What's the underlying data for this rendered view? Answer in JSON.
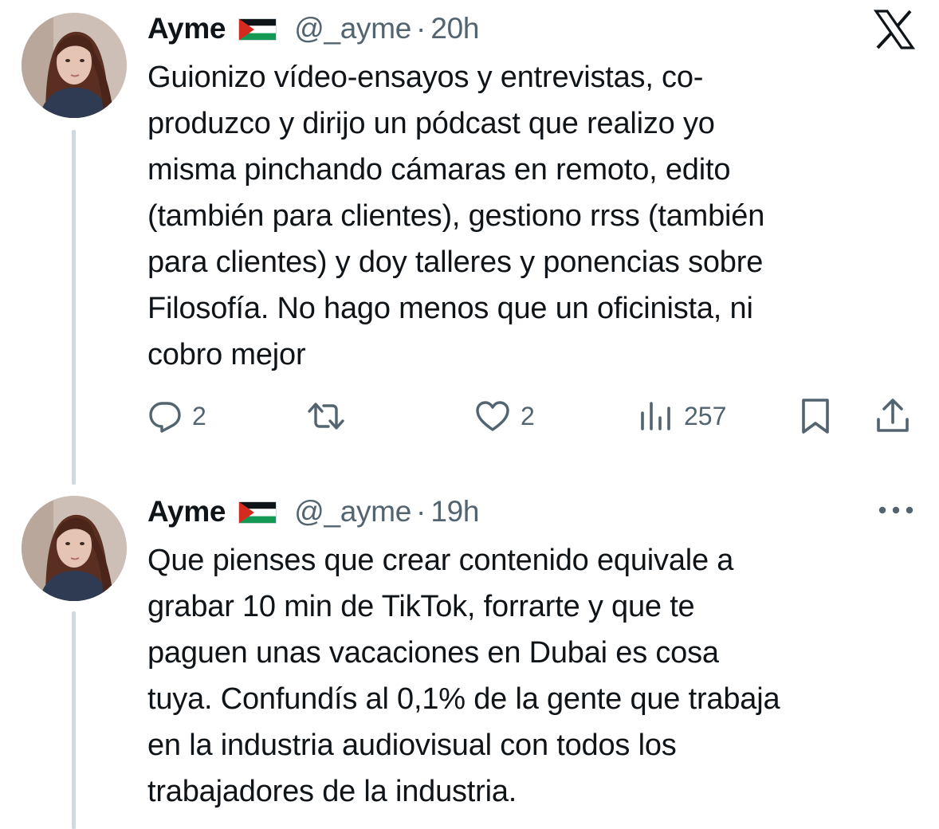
{
  "tweets": [
    {
      "name": "Ayme",
      "flag": "palestine-flag",
      "handle": "@_ayme",
      "separator": "·",
      "time": "20h",
      "corner_icon": "x-logo",
      "lines": [
        "Guionizo vídeo-ensayos y entrevistas, co-",
        "produzco y dirijo un pódcast que realizo yo",
        "misma pinchando cámaras en remoto, edito",
        "(también para clientes), gestiono rrss (también",
        "para clientes) y doy talleres y ponencias sobre",
        "Filosofía. No hago menos que un oficinista, ni",
        "cobro mejor"
      ],
      "actions": {
        "replies": "2",
        "retweets": "",
        "likes": "2",
        "views": "257"
      }
    },
    {
      "name": "Ayme",
      "flag": "palestine-flag",
      "handle": "@_ayme",
      "separator": "·",
      "time": "19h",
      "corner_icon": "more-icon",
      "lines": [
        "Que pienses que crear contenido equivale a",
        "grabar 10 min de TikTok, forrarte y que te",
        "paguen unas vacaciones en Dubai es cosa",
        "tuya. Confundís al 0,1% de la gente que trabaja",
        "en la industria audiovisual con todos los",
        "trabajadores de la industria."
      ]
    }
  ],
  "colors": {
    "text": "#0f1419",
    "secondary": "#536471",
    "thread_line": "#cfd9de",
    "flag_red": "#d52b1e",
    "flag_green": "#149954"
  }
}
